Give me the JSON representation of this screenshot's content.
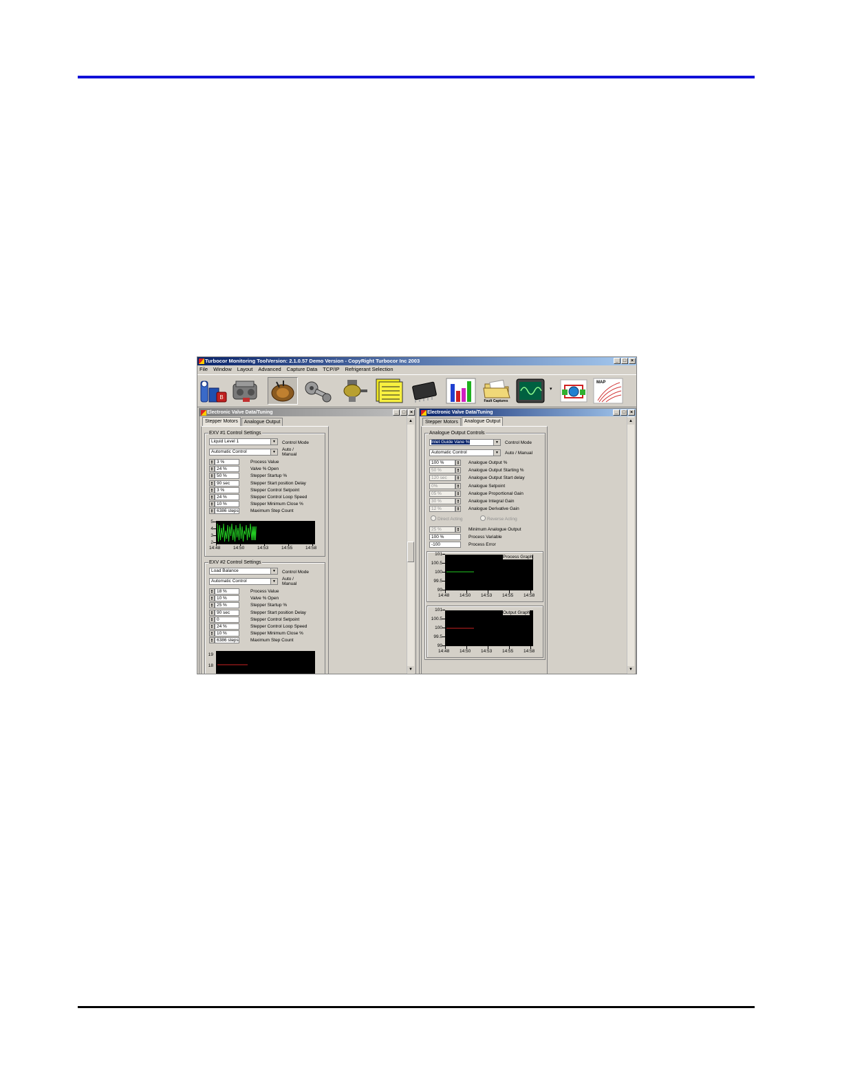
{
  "app": {
    "title": "Turbocor Monitoring ToolVersion: 2.1.0.57 Demo Version - CopyRight Turbocor Inc 2003",
    "menu": [
      "File",
      "Window",
      "Layout",
      "Advanced",
      "Capture Data",
      "TCP/IP",
      "Refrigerant Selection"
    ],
    "toolbar": {
      "fault_label": "Fault Captures",
      "map_label": "MAP",
      "overflow": "▾"
    }
  },
  "window_buttons": {
    "min": "_",
    "max": "□",
    "close": "×"
  },
  "left_window": {
    "title": "Electronic Valve Data/Tuning",
    "tabs": [
      "Stepper Motors",
      "Analogue Output"
    ],
    "exv1": {
      "title": "EXV #1 Control Settings",
      "control_mode": "Liquid Level 1",
      "control_mode_label": "Control Mode",
      "auto_value": "Automatic Control",
      "auto_label_1": "Auto /",
      "auto_label_2": "Manual",
      "rows": [
        {
          "value": "3 %",
          "label": "Process Value"
        },
        {
          "value": "24 %",
          "label": "Valve % Open"
        },
        {
          "value": "50 %",
          "label": "Stepper Startup %"
        },
        {
          "value": "90 sec",
          "label": "Stepper Start position Delay"
        },
        {
          "value": "3 %",
          "label": "Stepper Control Setpoint"
        },
        {
          "value": "24 %",
          "label": "Stepper Control Loop Speed"
        },
        {
          "value": "10 %",
          "label": "Stepper Minimum Close %"
        },
        {
          "value": "6386 steps",
          "label": "Maximum Step Count"
        }
      ],
      "graph": {
        "y": [
          "5",
          "4",
          "3",
          "2"
        ],
        "x": [
          "14:48",
          "14:50",
          "14:53",
          "14:55",
          "14:58"
        ],
        "color": "#22cc22"
      }
    },
    "exv2": {
      "title": "EXV #2 Control Settings",
      "control_mode": "Load Balance",
      "control_mode_label": "Control Mode",
      "auto_value": "Automatic Control",
      "auto_label_1": "Auto /",
      "auto_label_2": "Manual",
      "rows": [
        {
          "value": "18 %",
          "label": "Process Value"
        },
        {
          "value": "10 %",
          "label": "Valve % Open"
        },
        {
          "value": "25 %",
          "label": "Stepper Startup %"
        },
        {
          "value": "90 sec",
          "label": "Stepper Start position Delay"
        },
        {
          "value": "0",
          "label": "Stepper Control Setpoint"
        },
        {
          "value": "24 %",
          "label": "Stepper Control Loop Speed"
        },
        {
          "value": "10 %",
          "label": "Stepper Minimum Close %"
        },
        {
          "value": "6386 steps",
          "label": "Maximum Step Count"
        }
      ],
      "graph": {
        "y": [
          "19",
          "18"
        ],
        "color": "#cc2222"
      }
    }
  },
  "right_window": {
    "title": "Electronic Valve Data/Tuning",
    "tabs": [
      "Stepper Motors",
      "Analogue Output"
    ],
    "group_title": "Analogue Output Controls",
    "control_mode": "Inlet Guide Vane %",
    "control_mode_label": "Control Mode",
    "auto_value": "Automatic Control",
    "auto_label": "Auto / Manual",
    "rows": [
      {
        "value": "100 %",
        "label": "Analogue Output %"
      },
      {
        "value": "50 %",
        "label": "Analogue Output Starting %"
      },
      {
        "value": "120 sec",
        "label": "Analogue Output Start delay"
      },
      {
        "value": "0%",
        "label": "Analogue Setpoint"
      },
      {
        "value": "05 %",
        "label": "Analogue Proportional Gain"
      },
      {
        "value": "30 %",
        "label": "Analogue Integral Gain"
      },
      {
        "value": "12 %",
        "label": "Analogue Derivative Gain"
      }
    ],
    "direct_acting": "Direct Acting",
    "reverse_acting": "Reverse Acting",
    "min_output": {
      "value": "25 %",
      "label": "Minimum Analogue Output"
    },
    "process_variable": {
      "value": "100 %",
      "label": "Process Variable"
    },
    "process_error": {
      "value": "-100",
      "label": "Process Error"
    },
    "process_graph": {
      "title": "Process Graph",
      "y": [
        "101",
        "100.5",
        "100",
        "99.5",
        "99"
      ],
      "x": [
        "14:48",
        "14:50",
        "14:53",
        "14:55",
        "14:58"
      ],
      "color": "#22cc22"
    },
    "output_graph": {
      "title": "Output Graph",
      "y": [
        "101",
        "100.5",
        "100",
        "99.5",
        "99"
      ],
      "x": [
        "14:48",
        "14:50",
        "14:53",
        "14:55",
        "14:58"
      ],
      "color": "#cc2222"
    }
  }
}
